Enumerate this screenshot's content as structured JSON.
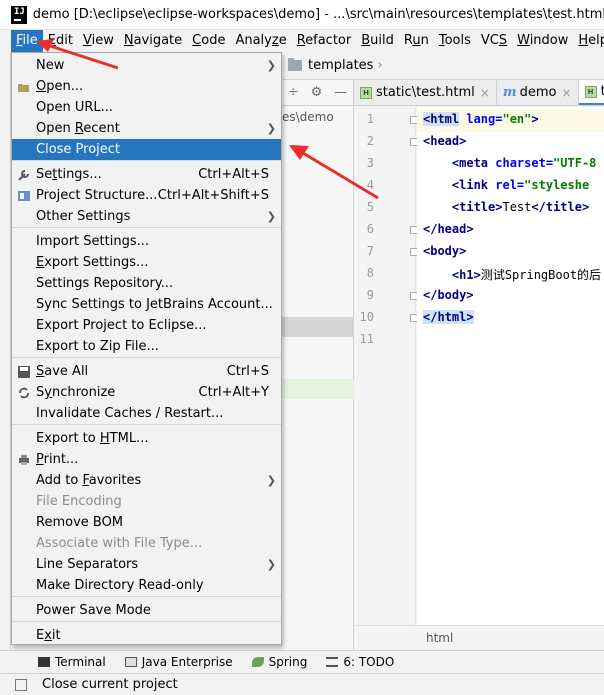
{
  "window": {
    "title": "demo [D:\\eclipse\\eclipse-workspaces\\demo] - ...\\src\\main\\resources\\templates\\test.html [demo] - Int"
  },
  "menubar": {
    "items": [
      {
        "label": "File",
        "underline": "F",
        "rest": "ile"
      },
      {
        "label": "Edit",
        "underline": "E",
        "rest": "dit"
      },
      {
        "label": "View",
        "underline": "V",
        "rest": "iew"
      },
      {
        "label": "Navigate",
        "underline": "N",
        "rest": "avigate"
      },
      {
        "label": "Code",
        "underline": "C",
        "rest": "ode"
      },
      {
        "label": "Analyze",
        "pre": "Analy",
        "underline": "z",
        "rest": "e"
      },
      {
        "label": "Refactor",
        "underline": "R",
        "rest": "efactor"
      },
      {
        "label": "Build",
        "underline": "B",
        "rest": "uild"
      },
      {
        "label": "Run",
        "pre": "R",
        "underline": "u",
        "rest": "n"
      },
      {
        "label": "Tools",
        "underline": "T",
        "rest": "ools"
      },
      {
        "label": "VCS",
        "pre": "VC",
        "underline": "S",
        "rest": ""
      },
      {
        "label": "Window",
        "underline": "W",
        "rest": "indow"
      },
      {
        "label": "Help",
        "underline": "H",
        "rest": "elp"
      }
    ]
  },
  "navbar": {
    "folder": "templates"
  },
  "project_panel": {
    "path_fragment": "es\\demo"
  },
  "tabs": [
    {
      "label": "static\\test.html",
      "icon": "html-file-icon"
    },
    {
      "label": "demo",
      "icon": "m-icon"
    },
    {
      "label": "te",
      "icon": "html-file-icon"
    }
  ],
  "editor": {
    "line_numbers": [
      "1",
      "2",
      "3",
      "4",
      "5",
      "6",
      "7",
      "8",
      "9",
      "10",
      "11"
    ],
    "lines": [
      {
        "t": "<html",
        "a": " lang=",
        "s": "\"en\"",
        "e": ">"
      },
      {
        "t": "<head>"
      },
      {
        "indent": "    ",
        "t": "<meta",
        "a": " charset=",
        "s": "\"UTF-8"
      },
      {
        "indent": "    ",
        "t": "<link",
        "a": " rel=",
        "s": "\"styleshe"
      },
      {
        "indent": "    ",
        "t": "<title>",
        "x": "Test",
        "t2": "</title>"
      },
      {
        "t": "</head>"
      },
      {
        "t": "<body>"
      },
      {
        "indent": "    ",
        "t": "<h1>",
        "x": "测试SpringBoot的后"
      },
      {
        "t": "</body>"
      },
      {
        "t": "</html>"
      },
      {
        "t": ""
      }
    ],
    "footer_breadcrumb": "html"
  },
  "file_menu": {
    "items": [
      {
        "label": "New",
        "submenu": true
      },
      {
        "label": "Open...",
        "icon": "open-folder-icon"
      },
      {
        "label": "Open URL..."
      },
      {
        "label": "Open Recent",
        "submenu": true
      },
      {
        "label": "Close Project",
        "selected": true
      },
      {
        "label": "Settings...",
        "shortcut": "Ctrl+Alt+S",
        "icon": "wrench-icon"
      },
      {
        "label": "Project Structure...",
        "shortcut": "Ctrl+Alt+Shift+S",
        "icon": "project-structure-icon"
      },
      {
        "label": "Other Settings",
        "submenu": true
      },
      {
        "label": "Import Settings..."
      },
      {
        "label": "Export Settings..."
      },
      {
        "label": "Settings Repository..."
      },
      {
        "label": "Sync Settings to JetBrains Account..."
      },
      {
        "label": "Export Project to Eclipse..."
      },
      {
        "label": "Export to Zip File..."
      },
      {
        "label": "Save All",
        "shortcut": "Ctrl+S",
        "icon": "save-icon"
      },
      {
        "label": "Synchronize",
        "shortcut": "Ctrl+Alt+Y",
        "icon": "sync-icon"
      },
      {
        "label": "Invalidate Caches / Restart..."
      },
      {
        "label": "Export to HTML..."
      },
      {
        "label": "Print...",
        "icon": "print-icon"
      },
      {
        "label": "Add to Favorites",
        "submenu": true
      },
      {
        "label": "File Encoding",
        "disabled": true
      },
      {
        "label": "Remove BOM"
      },
      {
        "label": "Associate with File Type...",
        "disabled": true
      },
      {
        "label": "Line Separators",
        "submenu": true
      },
      {
        "label": "Make Directory Read-only"
      },
      {
        "label": "Power Save Mode"
      },
      {
        "label": "Exit"
      }
    ]
  },
  "toolwindows": [
    {
      "label": "Terminal",
      "icon": "terminal-icon"
    },
    {
      "label": "Java Enterprise",
      "icon": "java-enterprise-icon"
    },
    {
      "label": "Spring",
      "icon": "spring-icon"
    },
    {
      "label": "6: TODO",
      "icon": "todo-icon"
    }
  ],
  "status": {
    "text": "Close current project"
  },
  "colors": {
    "accent": "#2675bf",
    "annotation": "#e8302a"
  }
}
